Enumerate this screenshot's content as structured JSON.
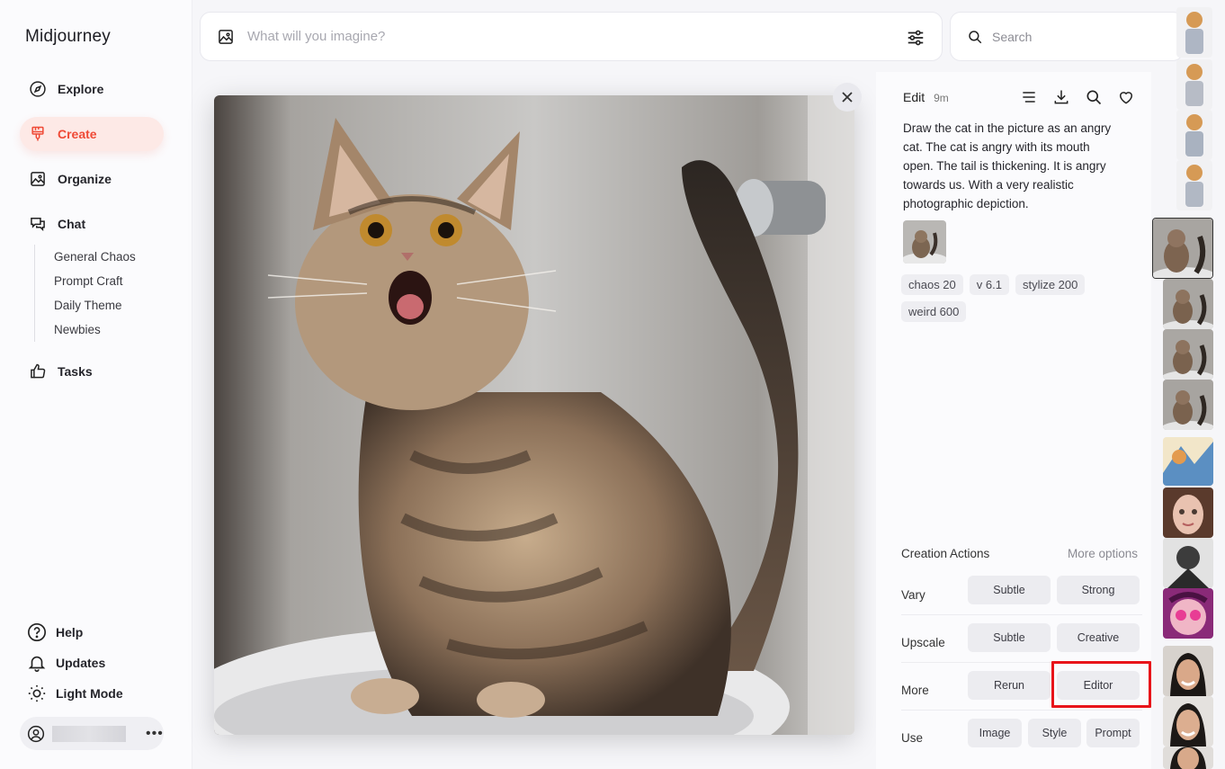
{
  "sidebar": {
    "brand": "Midjourney",
    "nav": [
      {
        "label": "Explore",
        "icon": "compass-icon"
      },
      {
        "label": "Create",
        "icon": "brush-icon"
      },
      {
        "label": "Organize",
        "icon": "image-icon"
      },
      {
        "label": "Chat",
        "icon": "chat-icon"
      },
      {
        "label": "Tasks",
        "icon": "thumbs-up-icon"
      }
    ],
    "chat_channels": [
      "General Chaos",
      "Prompt Craft",
      "Daily Theme",
      "Newbies"
    ],
    "bottom": [
      {
        "label": "Help",
        "icon": "help-icon"
      },
      {
        "label": "Updates",
        "icon": "bell-icon"
      },
      {
        "label": "Light Mode",
        "icon": "sun-icon"
      }
    ],
    "user_menu": "•••"
  },
  "topbar": {
    "prompt_placeholder": "What will you imagine?",
    "search_placeholder": "Search"
  },
  "detail": {
    "edit_label": "Edit",
    "age": "9m",
    "prompt": "Draw the cat in the picture as an angry cat. The cat is angry with its mouth open. The tail is thickening. It is angry towards us. With a very realistic photographic depiction.",
    "params": [
      "chaos 20",
      "v 6.1",
      "stylize 200",
      "weird 600"
    ],
    "actions_title": "Creation Actions",
    "more_options": "More options",
    "rows": [
      {
        "label": "Vary",
        "buttons": [
          "Subtle",
          "Strong"
        ]
      },
      {
        "label": "Upscale",
        "buttons": [
          "Subtle",
          "Creative"
        ]
      },
      {
        "label": "More",
        "buttons": [
          "Rerun",
          "Editor"
        ]
      },
      {
        "label": "Use",
        "buttons": [
          "Image",
          "Style",
          "Prompt"
        ]
      }
    ]
  },
  "colors": {
    "accent": "#ef4a36",
    "highlight": "#e8141a",
    "background": "#f6f6f9"
  }
}
